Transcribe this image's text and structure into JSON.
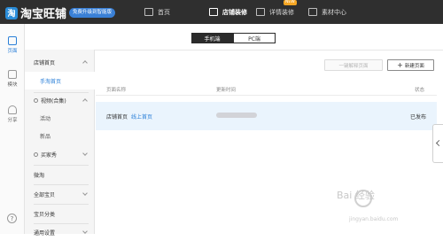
{
  "app": {
    "logo_text": "淘宝旺铺",
    "badge": "免费升级到智能版"
  },
  "nav": [
    {
      "label": "首页"
    },
    {
      "label": "店铺装修"
    },
    {
      "label": "详情装修"
    },
    {
      "label": "素材中心"
    }
  ],
  "nav_badge": "NEW",
  "rail": {
    "pages": "页面",
    "modules": "模块",
    "share": "分享",
    "help": "?"
  },
  "toggle": {
    "mobile": "手机端",
    "pc": "PC端"
  },
  "sidebar": [
    {
      "label": "店铺首页"
    },
    {
      "label": "手淘首页"
    },
    {
      "label": "视频(合集)"
    },
    {
      "label": "活动"
    },
    {
      "label": "新品"
    },
    {
      "label": "买家秀"
    },
    {
      "label": "微淘"
    },
    {
      "label": "全部宝贝"
    },
    {
      "label": "宝贝分类"
    },
    {
      "label": "通用设置"
    }
  ],
  "actions": {
    "batch": "一键解释页面",
    "new_page": "新建页面"
  },
  "table": {
    "headers": {
      "name": "页面名称",
      "updated": "更新时间",
      "status": "状态"
    },
    "rows": [
      {
        "name": "店铺首页",
        "tag": "线上首页",
        "updated": "",
        "status": "已发布"
      }
    ]
  },
  "watermark": {
    "text": "Bai 经验",
    "url": "jingyan.baidu.com"
  }
}
